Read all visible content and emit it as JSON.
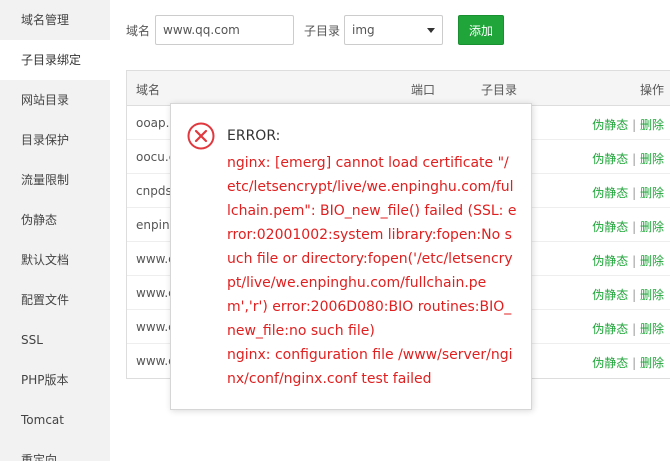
{
  "sidebar": {
    "items": [
      {
        "label": "域名管理"
      },
      {
        "label": "子目录绑定"
      },
      {
        "label": "网站目录"
      },
      {
        "label": "目录保护"
      },
      {
        "label": "流量限制"
      },
      {
        "label": "伪静态"
      },
      {
        "label": "默认文档"
      },
      {
        "label": "配置文件"
      },
      {
        "label": "SSL"
      },
      {
        "label": "PHP版本"
      },
      {
        "label": "Tomcat"
      },
      {
        "label": "重定向"
      }
    ],
    "active_index": 1
  },
  "form": {
    "domain_label": "域名",
    "domain_value": "www.qq.com",
    "subdir_label": "子目录",
    "subdir_value": "img",
    "add_label": "添加"
  },
  "table": {
    "headers": {
      "domain": "域名",
      "port": "端口",
      "subdir": "子目录",
      "ops": "操作"
    },
    "rows": [
      {
        "domain": "ooap.c"
      },
      {
        "domain": "oocu.c"
      },
      {
        "domain": "cnpds"
      },
      {
        "domain": "enping"
      },
      {
        "domain": "www.c"
      },
      {
        "domain": "www.c"
      },
      {
        "domain": "www.c"
      },
      {
        "domain": "www.e"
      }
    ],
    "op_rewrite": "伪静态",
    "op_separator": "|",
    "op_delete": "删除"
  },
  "dialog": {
    "title": "ERROR:",
    "message": "nginx: [emerg] cannot load certificate \"/etc/letsencrypt/live/we.enpinghu.com/fullchain.pem\": BIO_new_file() failed (SSL: error:02001002:system library:fopen:No such file or directory:fopen('/etc/letsencrypt/live/we.enpinghu.com/fullchain.pem','r') error:2006D080:BIO routines:BIO_new_file:no such file)",
    "message2": "nginx: configuration file /www/server/nginx/conf/nginx.conf test failed"
  },
  "colors": {
    "accent": "#20a53a",
    "error": "#e02020",
    "sidebar_bg": "#f2f2f2"
  }
}
